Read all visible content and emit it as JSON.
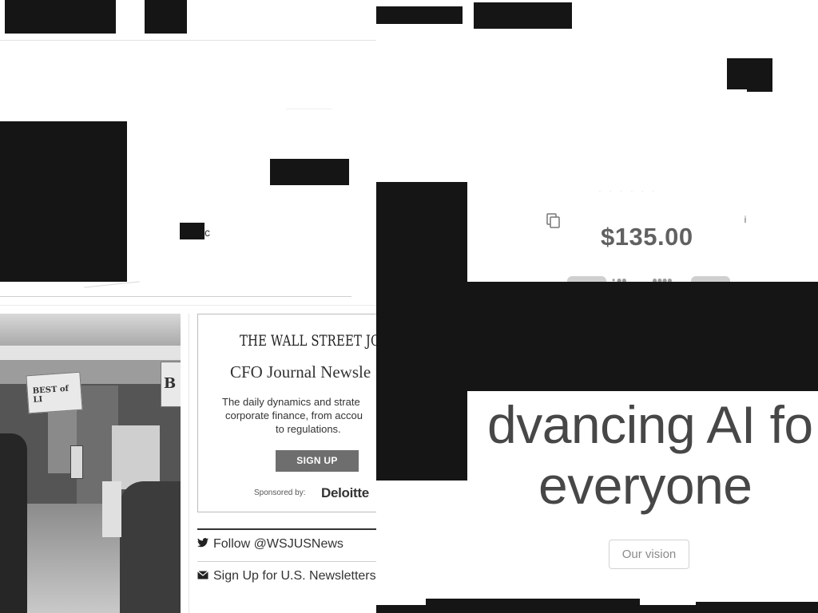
{
  "ad": {
    "masthead": "THE WALL STREET JOURN",
    "title": "CFO Journal Newsle",
    "description_lines": [
      "The daily dynamics and strate",
      "corporate finance, from accou",
      "to regulations."
    ],
    "signup_label": "SIGN UP",
    "sponsor_label": "Sponsored by:",
    "sponsor_name": "Deloitte"
  },
  "social": {
    "follow_label": "Follow @WSJUSNews",
    "follow_icon": "twitter-icon",
    "newsletter_label": "Sign Up for U.S. Newsletters a",
    "newsletter_icon": "mail-icon"
  },
  "left_snippet": {
    "fragment": "c"
  },
  "photo": {
    "sign_left": "BEST of LI",
    "sign_right": "B"
  },
  "product": {
    "price": "$135.00",
    "copy_icon": "copy-icon",
    "info_icon": "info-icon"
  },
  "hero": {
    "line1": "dvancing AI fo",
    "line2": "everyone",
    "vision_button": "Our vision"
  },
  "colors": {
    "redaction": "#151515",
    "signup_bg": "#6e6e6e",
    "hero_text": "#474747",
    "price_text": "#616161"
  }
}
